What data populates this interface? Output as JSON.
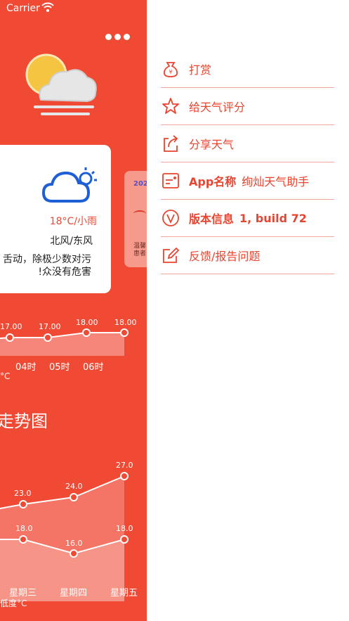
{
  "status_bar": {
    "carrier": "Carrier"
  },
  "left_panel": {
    "condition": "18°C/小雨",
    "wind": "北风/东风",
    "description_line1": "舌动，除极少数对污",
    "description_line2": "众没有危害!",
    "alert_card": {
      "year": "202",
      "tip_line1": "温馨",
      "tip_line2": "患者"
    },
    "hourly": {
      "values": [
        "17.00",
        "17.00",
        "18.00",
        "18.00"
      ],
      "labels": [
        "04时",
        "05时",
        "06时"
      ],
      "unit": "°C"
    },
    "trend_title": "走势图",
    "weekly": {
      "high_values": [
        "23.0",
        "24.0",
        "27.0"
      ],
      "low_values": [
        "18.0",
        "16.0",
        "18.0"
      ],
      "days": [
        "星期三",
        "星期四",
        "星期五"
      ],
      "low_legend": "低度°C"
    },
    "colors": {
      "panel": "#f04a34",
      "accent": "#e8442f"
    }
  },
  "menu": {
    "items": [
      {
        "label": "打赏",
        "icon": "money-bag-icon"
      },
      {
        "label": "给天气评分",
        "icon": "star-icon"
      },
      {
        "label": "分享天气",
        "icon": "share-icon"
      },
      {
        "label": "App名称",
        "value": "绚灿天气助手",
        "icon": "card-icon"
      },
      {
        "label": "版本信息",
        "value": "1, build 72",
        "icon": "version-icon"
      },
      {
        "label": "反馈/报告问题",
        "icon": "edit-icon"
      }
    ]
  }
}
